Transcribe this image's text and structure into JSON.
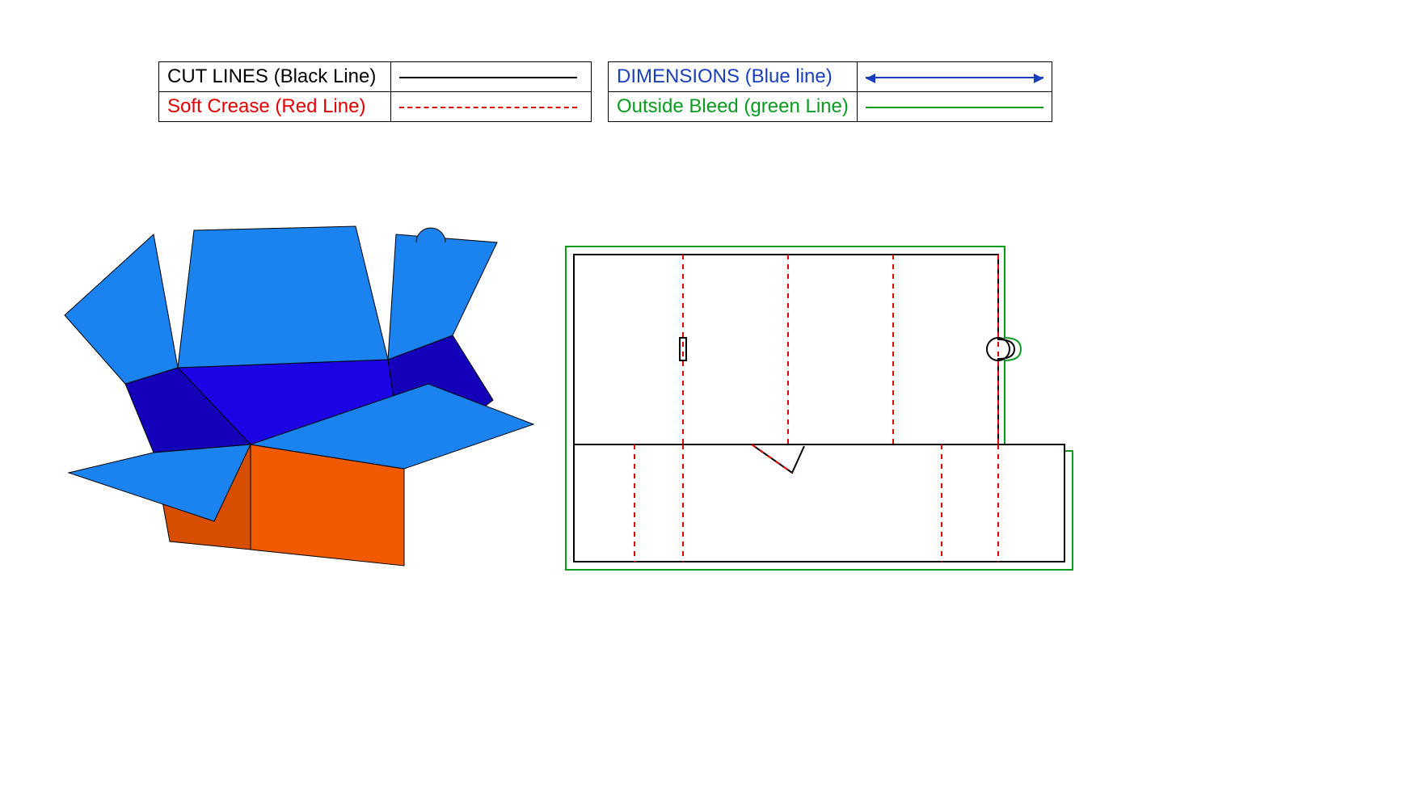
{
  "legend_left": {
    "row1_label": "CUT LINES (Black Line)",
    "row2_label": "Soft Crease (Red Line)"
  },
  "legend_right": {
    "row1_label": "DIMENSIONS (Blue line)",
    "row2_label": "Outside Bleed (green Line)"
  },
  "colors": {
    "cut_line": "#000000",
    "soft_crease": "#e40000",
    "dimensions": "#1a3fbd",
    "outside_bleed": "#0a9c1f",
    "box_top_outer": "#1a83f0",
    "box_top_inner": "#1c03e6",
    "box_body": "#f15a00"
  },
  "diagram": {
    "description_3d": "Open rectangular box rendered isometrically — orange body with blue lid flaps open on all four sides, small circular tab on back lid.",
    "description_dieline": "Flat dieline template: outer bleed rectangle in green, cut outline in black, vertical red dashed fold lines dividing upper lid panels and lower body panels, small rectangular slot and circular tuck tab on right edge, triangular notch on lower seam."
  }
}
